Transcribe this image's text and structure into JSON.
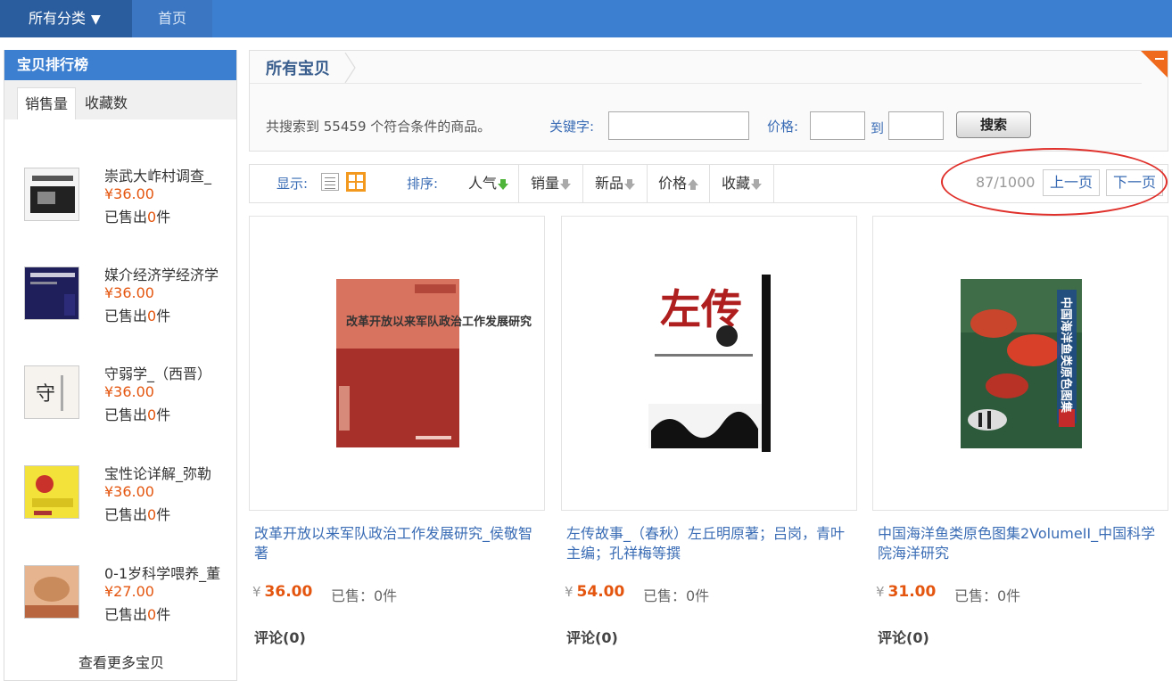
{
  "topnav": {
    "category_label": "所有分类",
    "home_label": "首页"
  },
  "sidebar": {
    "title": "宝贝排行榜",
    "tabs": [
      {
        "label": "销售量",
        "active": true
      },
      {
        "label": "收藏数",
        "active": false
      }
    ],
    "items": [
      {
        "name": "崇武大岞村调查_",
        "price": "¥36.00",
        "sold_prefix": "已售出",
        "sold_count": "0",
        "sold_suffix": "件"
      },
      {
        "name": "媒介经济学经济学",
        "price": "¥36.00",
        "sold_prefix": "已售出",
        "sold_count": "0",
        "sold_suffix": "件"
      },
      {
        "name": "守弱学_（西晋）",
        "price": "¥36.00",
        "sold_prefix": "已售出",
        "sold_count": "0",
        "sold_suffix": "件"
      },
      {
        "name": "宝性论详解_弥勒",
        "price": "¥36.00",
        "sold_prefix": "已售出",
        "sold_count": "0",
        "sold_suffix": "件"
      },
      {
        "name": "0-1岁科学喂养_董",
        "price": "¥27.00",
        "sold_prefix": "已售出",
        "sold_count": "0",
        "sold_suffix": "件"
      }
    ],
    "more_label": "查看更多宝贝"
  },
  "breadcrumb": {
    "label": "所有宝贝"
  },
  "search": {
    "result_text": "共搜索到 55459 个符合条件的商品。",
    "keyword_label": "关键字:",
    "keyword_value": "",
    "price_label": "价格:",
    "price_from": "",
    "to_label": "到",
    "price_to": "",
    "button_label": "搜索"
  },
  "toolbar": {
    "display_label": "显示:",
    "sort_label": "排序:",
    "sort_options": [
      "人气",
      "销量",
      "新品",
      "价格",
      "收藏"
    ],
    "page_info": "87/1000",
    "prev_label": "上一页",
    "next_label": "下一页"
  },
  "products": [
    {
      "title": "改革开放以来军队政治工作发展研究_侯敬智著",
      "currency": "¥",
      "price": "36.00",
      "sold": "已售：0件",
      "reviews": "评论(0)",
      "cover_text": "改革开放以来军队政治工作发展研究"
    },
    {
      "title": "左传故事_（春秋）左丘明原著；吕岗，青叶主编；孔祥梅等撰",
      "currency": "¥",
      "price": "54.00",
      "sold": "已售：0件",
      "reviews": "评论(0)",
      "cover_text": "左传"
    },
    {
      "title": "中国海洋鱼类原色图集2VolumeII_中国科学院海洋研究",
      "currency": "¥",
      "price": "31.00",
      "sold": "已售：0件",
      "reviews": "评论(0)",
      "cover_text": "中国海洋鱼类原色图集"
    }
  ],
  "colors": {
    "accent": "#3c7fd1",
    "price": "#e4560f",
    "link": "#3a6cb5",
    "highlight_ring": "#e0302b"
  }
}
